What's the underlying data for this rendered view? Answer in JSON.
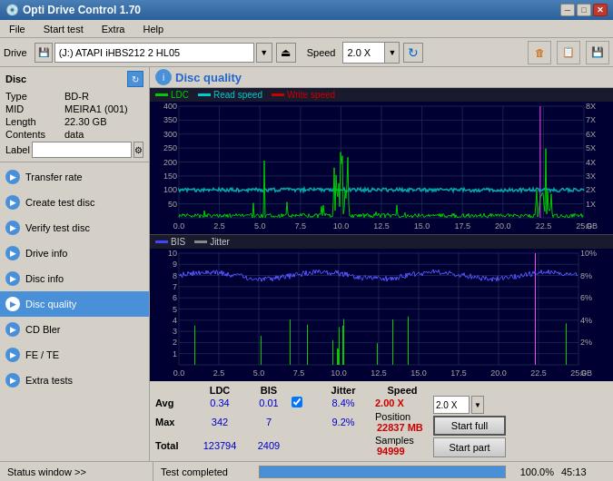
{
  "titlebar": {
    "title": "Opti Drive Control 1.70",
    "icon": "●",
    "min_label": "─",
    "max_label": "□",
    "close_label": "✕"
  },
  "menubar": {
    "items": [
      "File",
      "Start test",
      "Extra",
      "Help"
    ]
  },
  "toolbar": {
    "drive_label": "Drive",
    "drive_value": "(J:)  ATAPI iHBS212  2 HL05",
    "speed_label": "Speed",
    "speed_value": "2.0 X"
  },
  "disc": {
    "title": "Disc",
    "type_label": "Type",
    "type_value": "BD-R",
    "mid_label": "MID",
    "mid_value": "MEIRA1 (001)",
    "length_label": "Length",
    "length_value": "22.30 GB",
    "contents_label": "Contents",
    "contents_value": "data",
    "label_label": "Label"
  },
  "nav": {
    "items": [
      {
        "id": "transfer-rate",
        "label": "Transfer rate",
        "active": false
      },
      {
        "id": "create-test-disc",
        "label": "Create test disc",
        "active": false
      },
      {
        "id": "verify-test-disc",
        "label": "Verify test disc",
        "active": false
      },
      {
        "id": "drive-info",
        "label": "Drive info",
        "active": false
      },
      {
        "id": "disc-info",
        "label": "Disc info",
        "active": false
      },
      {
        "id": "disc-quality",
        "label": "Disc quality",
        "active": true
      },
      {
        "id": "cd-bler",
        "label": "CD Bler",
        "active": false
      },
      {
        "id": "fe-te",
        "label": "FE / TE",
        "active": false
      },
      {
        "id": "extra-tests",
        "label": "Extra tests",
        "active": false
      }
    ]
  },
  "content": {
    "title": "Disc quality",
    "legend1": {
      "items": [
        {
          "label": "LDC",
          "color": "#00cc00"
        },
        {
          "label": "Read speed",
          "color": "#00cccc"
        },
        {
          "label": "Write speed",
          "color": "#cc0000"
        }
      ]
    },
    "legend2": {
      "items": [
        {
          "label": "BIS",
          "color": "#0000ff"
        },
        {
          "label": "Jitter",
          "color": "#888888"
        }
      ]
    },
    "chart1": {
      "y_labels": [
        "400",
        "350",
        "300",
        "250",
        "200",
        "150",
        "100",
        "50"
      ],
      "x_labels": [
        "0.0",
        "2.5",
        "5.0",
        "7.5",
        "10.0",
        "12.5",
        "15.0",
        "17.5",
        "20.0",
        "22.5",
        "25.0"
      ],
      "y_right": [
        "8X",
        "7X",
        "6X",
        "5X",
        "4X",
        "3X",
        "2X",
        "1X"
      ]
    },
    "chart2": {
      "y_labels": [
        "10",
        "9",
        "8",
        "7",
        "6",
        "5",
        "4",
        "3",
        "2",
        "1"
      ],
      "x_labels": [
        "0.0",
        "2.5",
        "5.0",
        "7.5",
        "10.0",
        "12.5",
        "15.0",
        "17.5",
        "20.0",
        "22.5",
        "25.0"
      ],
      "y_right": [
        "10%",
        "8%",
        "6%",
        "4%",
        "2%"
      ]
    }
  },
  "stats": {
    "headers": [
      "",
      "LDC",
      "BIS",
      "",
      "Jitter",
      "Speed",
      ""
    ],
    "avg_label": "Avg",
    "avg_ldc": "0.34",
    "avg_bis": "0.01",
    "avg_jitter": "8.4%",
    "max_label": "Max",
    "max_ldc": "342",
    "max_bis": "7",
    "max_jitter": "9.2%",
    "total_label": "Total",
    "total_ldc": "123794",
    "total_bis": "2409",
    "speed_label": "Speed",
    "speed_value": "2.00 X",
    "position_label": "Position",
    "position_value": "22837 MB",
    "samples_label": "Samples",
    "samples_value": "94999",
    "start_full_label": "Start full",
    "start_part_label": "Start part",
    "speed_select": "2.0 X"
  },
  "statusbar": {
    "status_window_label": "Status window >>",
    "completed_label": "Test completed",
    "progress": "100.0%",
    "time": "45:13"
  }
}
